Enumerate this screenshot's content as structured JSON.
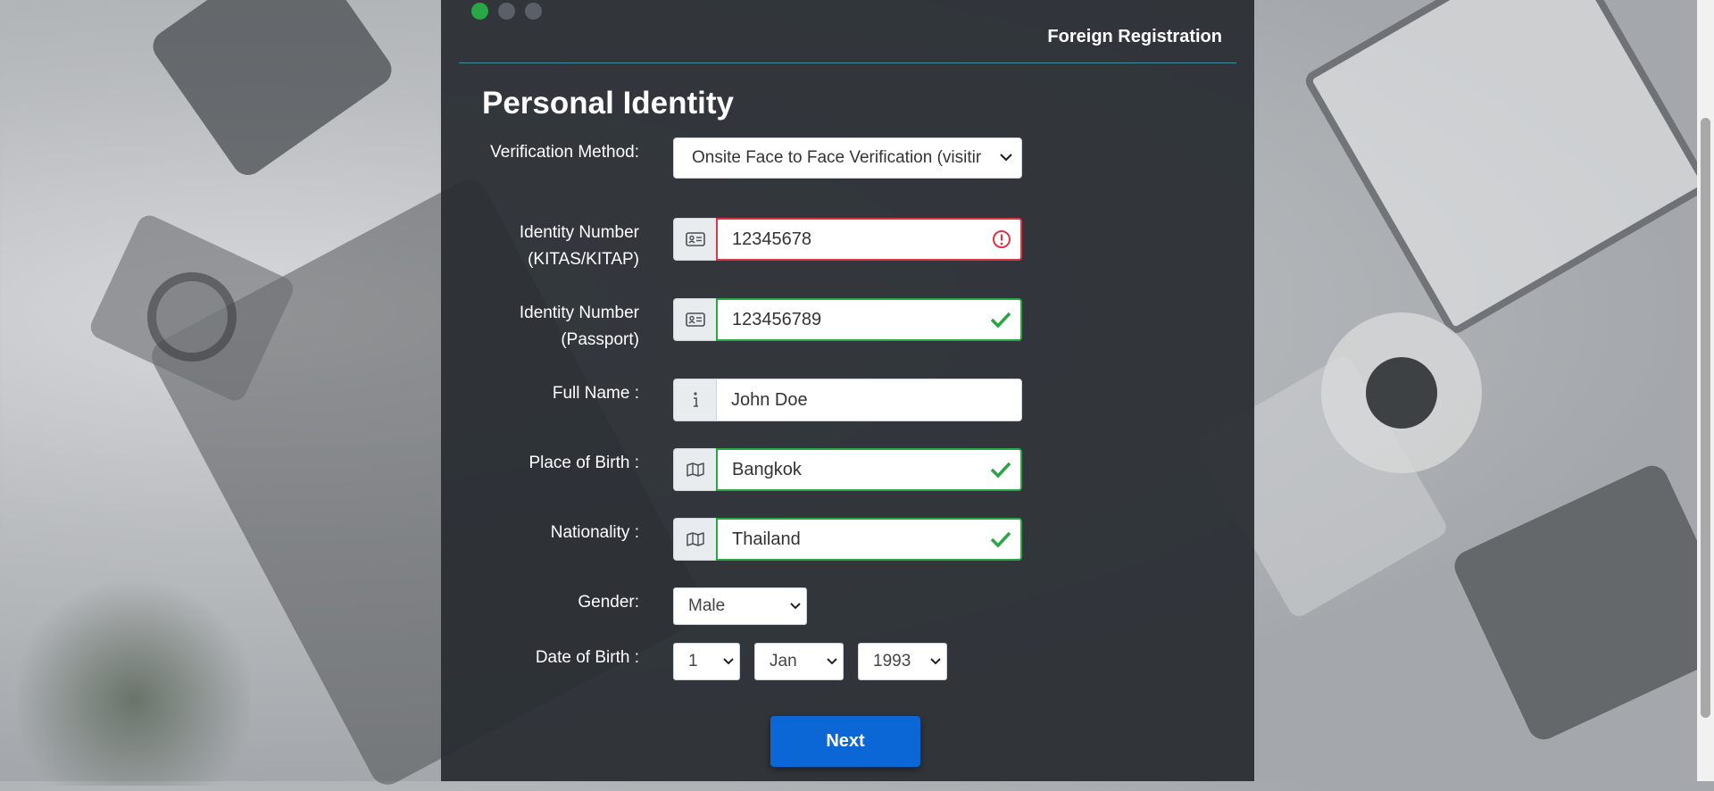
{
  "header": {
    "title": "Foreign Registration"
  },
  "steps": {
    "total": 3,
    "active": 1
  },
  "section_title": "Personal Identity",
  "form": {
    "verification": {
      "label": "Verification Method:",
      "value": "Onsite Face to Face Verification (visitir"
    },
    "kitas": {
      "label": "Identity Number (KITAS/KITAP)",
      "value": "12345678",
      "state": "invalid"
    },
    "passport": {
      "label": "Identity Number (Passport)",
      "value": "123456789",
      "state": "valid"
    },
    "full_name": {
      "label": "Full Name :",
      "value": "John Doe"
    },
    "place_of_birth": {
      "label": "Place of Birth :",
      "value": "Bangkok",
      "state": "valid"
    },
    "nationality": {
      "label": "Nationality :",
      "value": "Thailand",
      "state": "valid"
    },
    "gender": {
      "label": "Gender:",
      "value": "Male"
    },
    "dob": {
      "label": "Date of Birth :",
      "day": "1",
      "month": "Jan",
      "year": "1993"
    }
  },
  "buttons": {
    "next": "Next"
  },
  "colors": {
    "valid": "#28a745",
    "invalid": "#dc3545",
    "primary": "#0b66d6",
    "active_step": "#28a745"
  },
  "icons": {
    "kitas": "id-card-icon",
    "passport": "id-card-icon",
    "full_name": "info-icon",
    "place_of_birth": "map-icon",
    "nationality": "map-icon",
    "valid": "check-icon",
    "invalid": "exclamation-circle-icon"
  }
}
